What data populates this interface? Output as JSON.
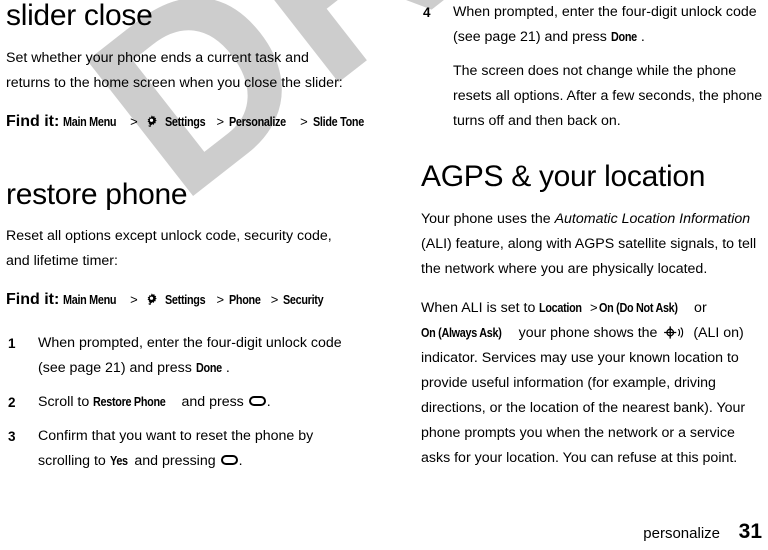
{
  "document": {
    "watermark": "DRAFT",
    "watermark_color": "#cdcdcd",
    "footer": {
      "section": "personalize",
      "page_number": "31"
    }
  },
  "left_column": {
    "section1": {
      "heading": "slider close",
      "intro": "Set whether your phone ends a current task and returns to the home screen when you close the slider:",
      "find_it": {
        "label": "Find it:",
        "path": [
          {
            "text": "Main Menu",
            "icon": null
          },
          {
            "text": "Settings",
            "icon": "gear-icon"
          },
          {
            "text": "Personalize",
            "icon": null
          },
          {
            "text": "Slide Tone",
            "icon": null
          }
        ],
        "separator": ">"
      }
    },
    "section2": {
      "heading": "restore phone",
      "intro": "Reset all options except unlock code, security code, and lifetime timer:",
      "find_it": {
        "label": "Find it:",
        "path": [
          {
            "text": "Main Menu",
            "icon": null
          },
          {
            "text": "Settings",
            "icon": "gear-icon"
          },
          {
            "text": "Phone",
            "icon": null
          },
          {
            "text": "Security",
            "icon": null
          }
        ],
        "separator": ">"
      },
      "steps": [
        {
          "num": "1",
          "parts": [
            {
              "t": "When prompted, enter the four-digit unlock code (see page 21) and press ",
              "s": "normal"
            },
            {
              "t": "Done",
              "s": "ui"
            },
            {
              "t": ".",
              "s": "normal"
            }
          ]
        },
        {
          "num": "2",
          "parts": [
            {
              "t": "Scroll to ",
              "s": "normal"
            },
            {
              "t": "Restore Phone",
              "s": "ui"
            },
            {
              "t": " and press ",
              "s": "normal"
            },
            {
              "t": "",
              "s": "key-icon"
            },
            {
              "t": ".",
              "s": "normal"
            }
          ]
        },
        {
          "num": "3",
          "parts": [
            {
              "t": "Confirm that you want to reset the phone by scrolling to ",
              "s": "normal"
            },
            {
              "t": "Yes",
              "s": "ui"
            },
            {
              "t": " and pressing ",
              "s": "normal"
            },
            {
              "t": "",
              "s": "key-icon"
            },
            {
              "t": ".",
              "s": "normal"
            }
          ]
        }
      ]
    }
  },
  "right_column": {
    "continued_step": {
      "num": "4",
      "parts": [
        {
          "t": "When prompted, enter the four-digit unlock code (see page 21) and press ",
          "s": "normal"
        },
        {
          "t": "Done",
          "s": "ui"
        },
        {
          "t": ".",
          "s": "normal"
        }
      ],
      "note": "The screen does not change while the phone resets all options. After a few seconds, the phone turns off and then back on."
    },
    "section1": {
      "heading": "AGPS & your location",
      "para1_pre": "Your phone uses the ",
      "para1_italic": "Automatic Location Information",
      "para1_post": " (ALI) feature, along with AGPS satellite signals, to tell the network where you are physically located.",
      "para2_pre": "When ALI is set to ",
      "para2_ui1": "Location",
      "para2_sep": ">",
      "para2_ui2": "On (Do Not Ask)",
      "para2_mid": " or ",
      "para2_ui3": "On (Always Ask)",
      "para2_post_pre": " your phone shows the ",
      "para2_icon": "ali-on-icon",
      "para2_post": " (ALI on) indicator. Services may use your known location to provide useful information (for example, driving directions, or the location of the nearest bank). Your phone prompts you when the network or a service asks for your location. You can refuse at this point."
    }
  }
}
